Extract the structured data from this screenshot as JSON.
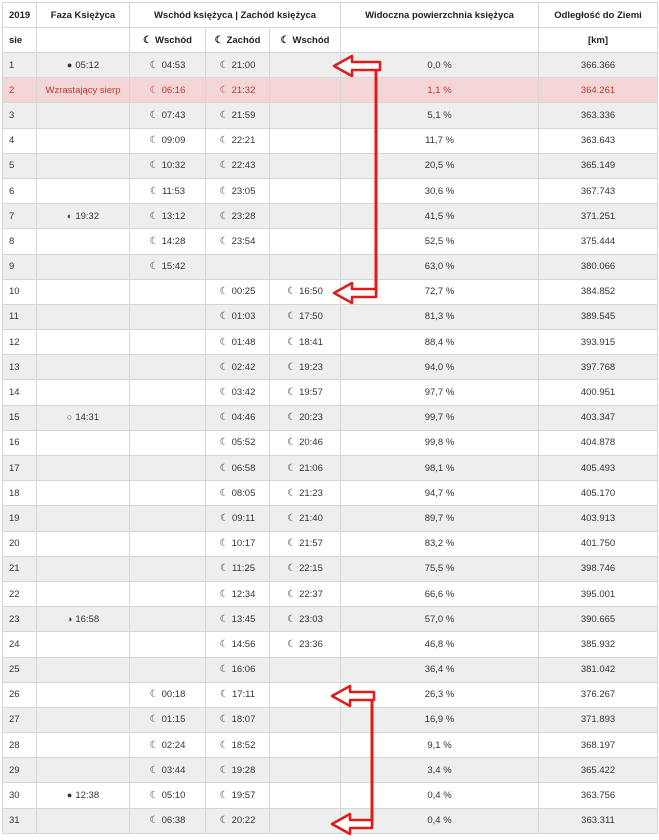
{
  "header": {
    "year": "2019",
    "phase": "Faza Księżyca",
    "riseset": "Wschód księżyca | Zachód księżyca",
    "visible": "Widoczna powierzchnia księżyca",
    "distance": "Odległość do Ziemi",
    "month": "sie",
    "rise1": "Wschód",
    "set": "Zachód",
    "rise2": "Wschód",
    "unit": "[km]"
  },
  "icons": {
    "rise": "moonrise-icon",
    "set": "moonset-icon"
  },
  "colors": {
    "highlight_bg": "#f5d6d6",
    "highlight_text": "#c0392b",
    "arrow": "#e01b1b"
  },
  "rows": [
    {
      "day": "1",
      "phase_sym": "●",
      "phase": "05:12",
      "rise1": "04:53",
      "set": "21:00",
      "rise2": "",
      "vis": "0,0 %",
      "dist": "366.366"
    },
    {
      "day": "2",
      "phase_sym": "",
      "phase": "Wzrastający sierp",
      "rise1": "06:16",
      "set": "21:32",
      "rise2": "",
      "vis": "1,1 %",
      "dist": "364.261"
    },
    {
      "day": "3",
      "phase_sym": "",
      "phase": "",
      "rise1": "07:43",
      "set": "21:59",
      "rise2": "",
      "vis": "5,1 %",
      "dist": "363.336"
    },
    {
      "day": "4",
      "phase_sym": "",
      "phase": "",
      "rise1": "09:09",
      "set": "22:21",
      "rise2": "",
      "vis": "11,7 %",
      "dist": "363.643"
    },
    {
      "day": "5",
      "phase_sym": "",
      "phase": "",
      "rise1": "10:32",
      "set": "22:43",
      "rise2": "",
      "vis": "20,5 %",
      "dist": "365.149"
    },
    {
      "day": "6",
      "phase_sym": "",
      "phase": "",
      "rise1": "11:53",
      "set": "23:05",
      "rise2": "",
      "vis": "30,6 %",
      "dist": "367.743"
    },
    {
      "day": "7",
      "phase_sym": "◐",
      "phase": "19:32",
      "rise1": "13:12",
      "set": "23:28",
      "rise2": "",
      "vis": "41,5 %",
      "dist": "371.251"
    },
    {
      "day": "8",
      "phase_sym": "",
      "phase": "",
      "rise1": "14:28",
      "set": "23:54",
      "rise2": "",
      "vis": "52,5 %",
      "dist": "375.444"
    },
    {
      "day": "9",
      "phase_sym": "",
      "phase": "",
      "rise1": "15:42",
      "set": "",
      "rise2": "",
      "vis": "63,0 %",
      "dist": "380.066"
    },
    {
      "day": "10",
      "phase_sym": "",
      "phase": "",
      "rise1": "",
      "set": "00:25",
      "rise2": "16:50",
      "vis": "72,7 %",
      "dist": "384.852"
    },
    {
      "day": "11",
      "phase_sym": "",
      "phase": "",
      "rise1": "",
      "set": "01:03",
      "rise2": "17:50",
      "vis": "81,3 %",
      "dist": "389.545"
    },
    {
      "day": "12",
      "phase_sym": "",
      "phase": "",
      "rise1": "",
      "set": "01:48",
      "rise2": "18:41",
      "vis": "88,4 %",
      "dist": "393.915"
    },
    {
      "day": "13",
      "phase_sym": "",
      "phase": "",
      "rise1": "",
      "set": "02:42",
      "rise2": "19:23",
      "vis": "94,0 %",
      "dist": "397.768"
    },
    {
      "day": "14",
      "phase_sym": "",
      "phase": "",
      "rise1": "",
      "set": "03:42",
      "rise2": "19:57",
      "vis": "97,7 %",
      "dist": "400.951"
    },
    {
      "day": "15",
      "phase_sym": "○",
      "phase": "14:31",
      "rise1": "",
      "set": "04:46",
      "rise2": "20:23",
      "vis": "99,7 %",
      "dist": "403.347"
    },
    {
      "day": "16",
      "phase_sym": "",
      "phase": "",
      "rise1": "",
      "set": "05:52",
      "rise2": "20:46",
      "vis": "99,8 %",
      "dist": "404.878"
    },
    {
      "day": "17",
      "phase_sym": "",
      "phase": "",
      "rise1": "",
      "set": "06:58",
      "rise2": "21:06",
      "vis": "98,1 %",
      "dist": "405.493"
    },
    {
      "day": "18",
      "phase_sym": "",
      "phase": "",
      "rise1": "",
      "set": "08:05",
      "rise2": "21:23",
      "vis": "94,7 %",
      "dist": "405.170"
    },
    {
      "day": "19",
      "phase_sym": "",
      "phase": "",
      "rise1": "",
      "set": "09:11",
      "rise2": "21:40",
      "vis": "89,7 %",
      "dist": "403.913"
    },
    {
      "day": "20",
      "phase_sym": "",
      "phase": "",
      "rise1": "",
      "set": "10:17",
      "rise2": "21:57",
      "vis": "83,2 %",
      "dist": "401.750"
    },
    {
      "day": "21",
      "phase_sym": "",
      "phase": "",
      "rise1": "",
      "set": "11:25",
      "rise2": "22:15",
      "vis": "75,5 %",
      "dist": "398.746"
    },
    {
      "day": "22",
      "phase_sym": "",
      "phase": "",
      "rise1": "",
      "set": "12:34",
      "rise2": "22:37",
      "vis": "66,6 %",
      "dist": "395.001"
    },
    {
      "day": "23",
      "phase_sym": "◑",
      "phase": "16:58",
      "rise1": "",
      "set": "13:45",
      "rise2": "23:03",
      "vis": "57,0 %",
      "dist": "390.665"
    },
    {
      "day": "24",
      "phase_sym": "",
      "phase": "",
      "rise1": "",
      "set": "14:56",
      "rise2": "23:36",
      "vis": "46,8 %",
      "dist": "385.932"
    },
    {
      "day": "25",
      "phase_sym": "",
      "phase": "",
      "rise1": "",
      "set": "16:06",
      "rise2": "",
      "vis": "36,4 %",
      "dist": "381.042"
    },
    {
      "day": "26",
      "phase_sym": "",
      "phase": "",
      "rise1": "00:18",
      "set": "17:11",
      "rise2": "",
      "vis": "26,3 %",
      "dist": "376.267"
    },
    {
      "day": "27",
      "phase_sym": "",
      "phase": "",
      "rise1": "01:15",
      "set": "18:07",
      "rise2": "",
      "vis": "16,9 %",
      "dist": "371.893"
    },
    {
      "day": "28",
      "phase_sym": "",
      "phase": "",
      "rise1": "02:24",
      "set": "18:52",
      "rise2": "",
      "vis": "9,1 %",
      "dist": "368.197"
    },
    {
      "day": "29",
      "phase_sym": "",
      "phase": "",
      "rise1": "03:44",
      "set": "19:28",
      "rise2": "",
      "vis": "3,4 %",
      "dist": "365.422"
    },
    {
      "day": "30",
      "phase_sym": "●",
      "phase": "12:38",
      "rise1": "05:10",
      "set": "19:57",
      "rise2": "",
      "vis": "0,4 %",
      "dist": "363.756"
    },
    {
      "day": "31",
      "phase_sym": "",
      "phase": "",
      "rise1": "06:38",
      "set": "20:22",
      "rise2": "",
      "vis": "0,4 %",
      "dist": "363.311"
    }
  ]
}
